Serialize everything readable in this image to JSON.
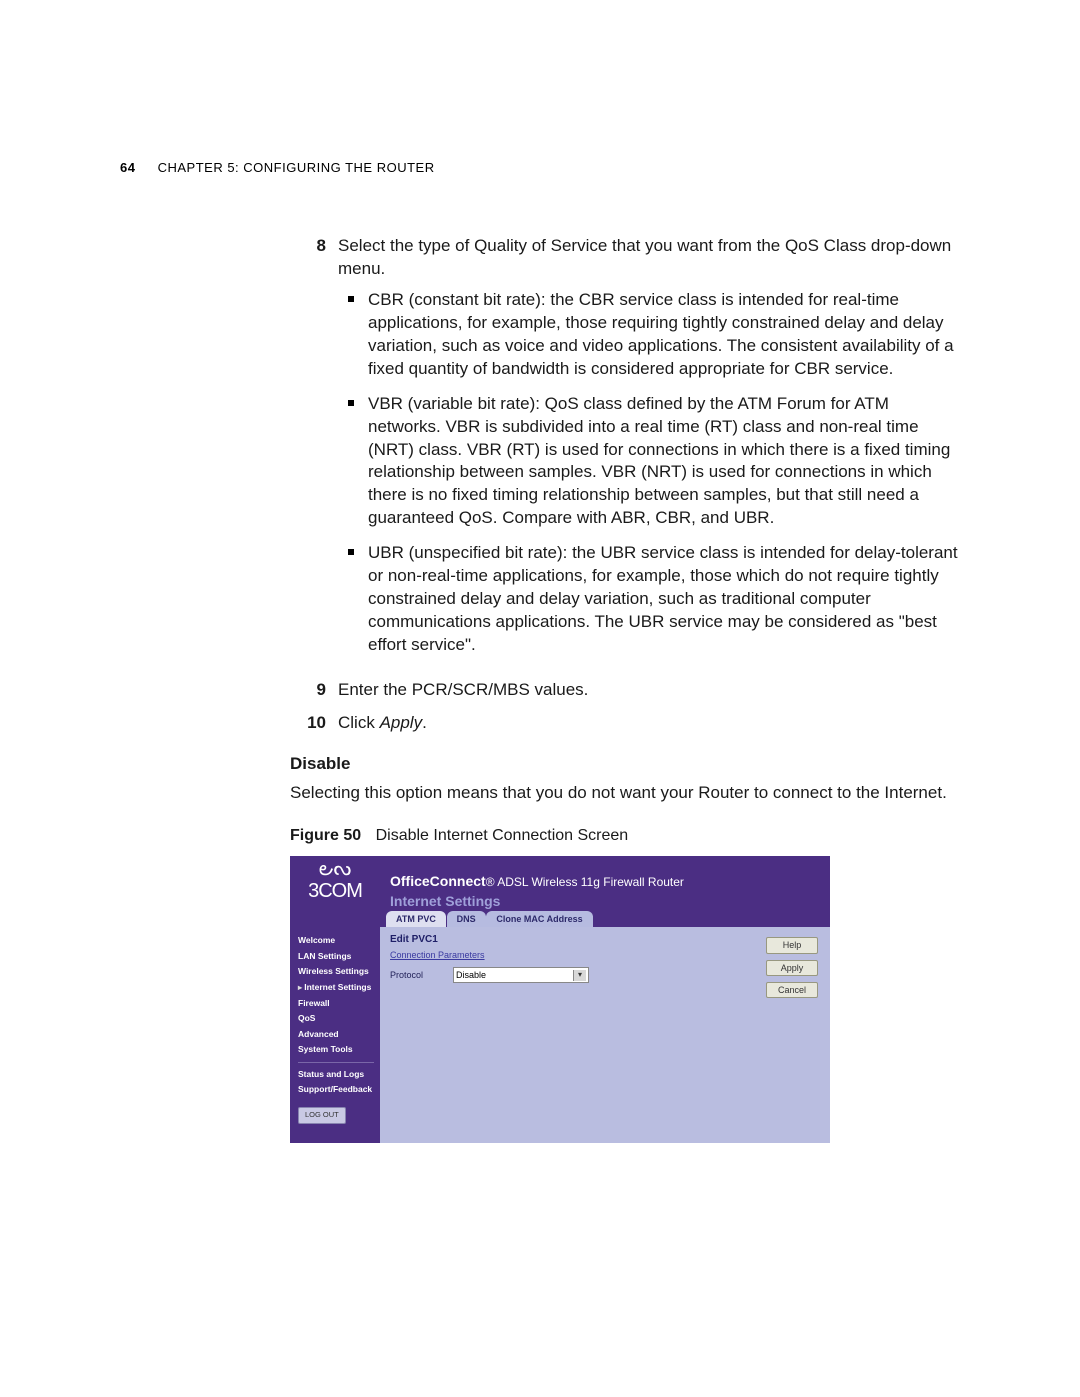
{
  "page_number": "64",
  "running_header": "CHAPTER 5: CONFIGURING THE ROUTER",
  "step8": {
    "num": "8",
    "intro": "Select the type of Quality of Service that you want from the QoS Class drop-down menu.",
    "bullets": [
      "CBR (constant bit rate): the CBR service class is intended for real-time applications, for example, those requiring tightly constrained delay and delay variation, such as voice and video applications. The consistent availability of a fixed quantity of bandwidth is considered appropriate for CBR service.",
      "VBR (variable bit rate): QoS class defined by the ATM Forum for ATM networks. VBR is subdivided into a real time (RT) class and non-real time (NRT) class. VBR (RT) is used for connections in which there is a fixed timing relationship between samples. VBR (NRT) is used for connections in which there is no fixed timing relationship between samples, but that still need a guaranteed QoS. Compare with ABR, CBR, and UBR.",
      "UBR (unspecified bit rate): the UBR service class is intended for delay-tolerant or non-real-time applications, for example, those which do not require tightly constrained delay and delay variation, such as traditional computer communications applications. The UBR service may be considered as \"best effort service\"."
    ]
  },
  "step9": {
    "num": "9",
    "text": "Enter the PCR/SCR/MBS values."
  },
  "step10": {
    "num": "10",
    "prefix": "Click ",
    "apply_word": "Apply",
    "suffix": "."
  },
  "disable_heading": "Disable",
  "disable_para": "Selecting this option means that you do not want your Router to connect to the Internet.",
  "figure": {
    "label": "Figure 50",
    "caption": "Disable Internet Connection Screen"
  },
  "router": {
    "brand_swirl": "౿ᔓ",
    "brand": "3COM",
    "product_bold": "OfficeConnect",
    "product_rest": "ADSL Wireless 11g Firewall Router",
    "section": "Internet Settings",
    "tabs": [
      "ATM PVC",
      "DNS",
      "Clone MAC Address"
    ],
    "nav": [
      "Welcome",
      "LAN Settings",
      "Wireless Settings",
      "Internet Settings",
      "Firewall",
      "QoS",
      "Advanced",
      "System Tools"
    ],
    "nav_active_index": 3,
    "nav_lower": [
      "Status and Logs",
      "Support/Feedback"
    ],
    "logout": "LOG OUT",
    "panel_title": "Edit PVC1",
    "panel_sub": "Connection Parameters",
    "protocol_label": "Protocol",
    "protocol_value": "Disable",
    "buttons": [
      "Help",
      "Apply",
      "Cancel"
    ]
  }
}
